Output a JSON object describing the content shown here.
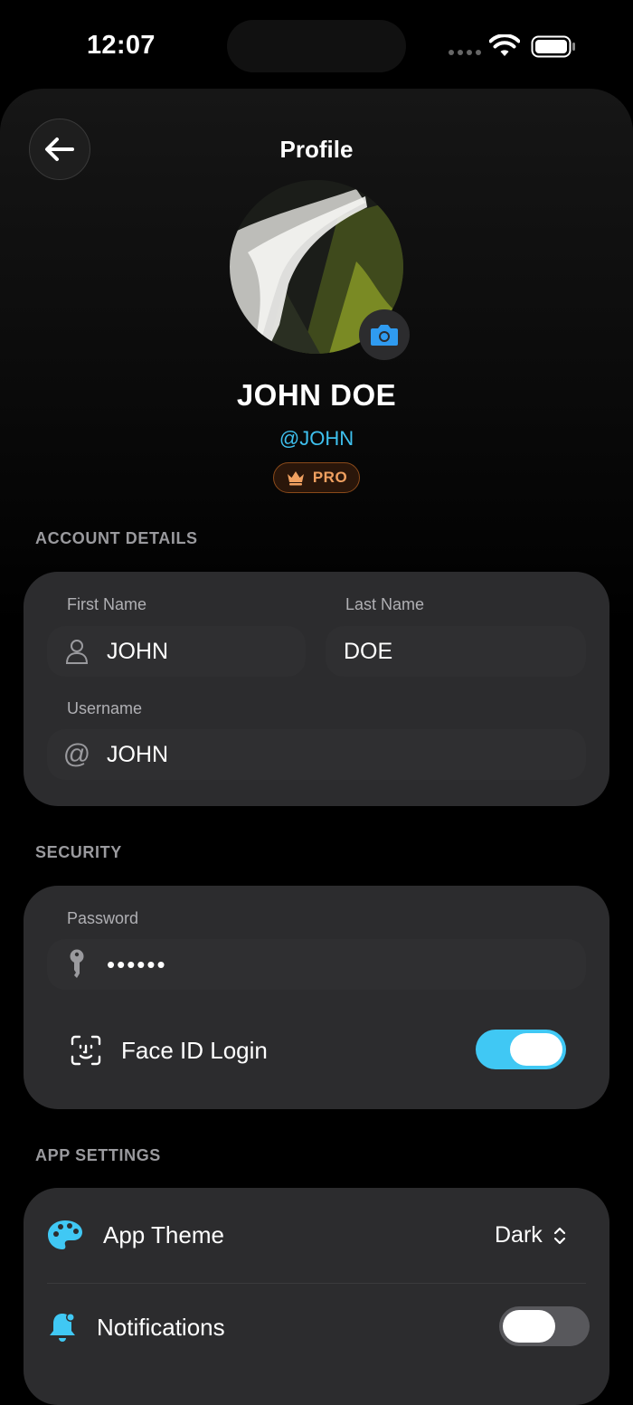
{
  "status_bar": {
    "time": "12:07"
  },
  "header": {
    "title": "Profile"
  },
  "profile": {
    "name": "JOHN DOE",
    "handle": "@JOHN",
    "badge": "PRO"
  },
  "account": {
    "section_label": "ACCOUNT DETAILS",
    "first_name_label": "First Name",
    "first_name_value": "JOHN",
    "last_name_label": "Last Name",
    "last_name_value": "DOE",
    "username_label": "Username",
    "username_value": "JOHN"
  },
  "security": {
    "section_label": "SECURITY",
    "password_label": "Password",
    "password_value": "••••••",
    "face_id_label": "Face ID Login",
    "face_id_enabled": true
  },
  "app_settings": {
    "section_label": "APP SETTINGS",
    "theme_label": "App Theme",
    "theme_value": "Dark",
    "notifications_label": "Notifications",
    "notifications_enabled": false
  },
  "colors": {
    "accent": "#3ec0ee",
    "toggle_on": "#40c8f4",
    "toggle_off": "#58585c",
    "pro": "#f0a060"
  },
  "icons": [
    "back-arrow-icon",
    "camera-icon",
    "crown-icon",
    "person-icon",
    "at-sign-icon",
    "key-icon",
    "face-id-icon",
    "palette-icon",
    "bell-icon",
    "chevron-up-down-icon",
    "wifi-icon",
    "battery-icon"
  ]
}
